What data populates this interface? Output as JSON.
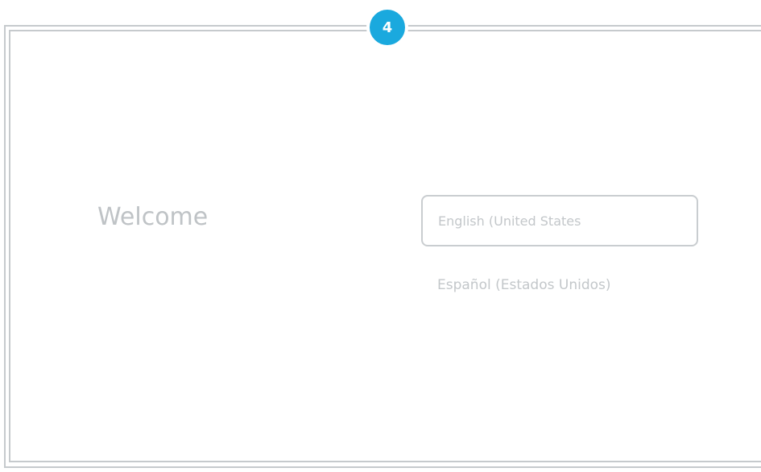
{
  "step": {
    "number": "4",
    "color": "#1aa9de"
  },
  "screen": {
    "title": "Welcome"
  },
  "languages": {
    "options": [
      {
        "label": "English (United States",
        "selected": true
      },
      {
        "label": "Español (Estados Unidos)",
        "selected": false
      }
    ]
  },
  "colors": {
    "frame": "#c6cacd",
    "text": "#c3c7ca"
  }
}
